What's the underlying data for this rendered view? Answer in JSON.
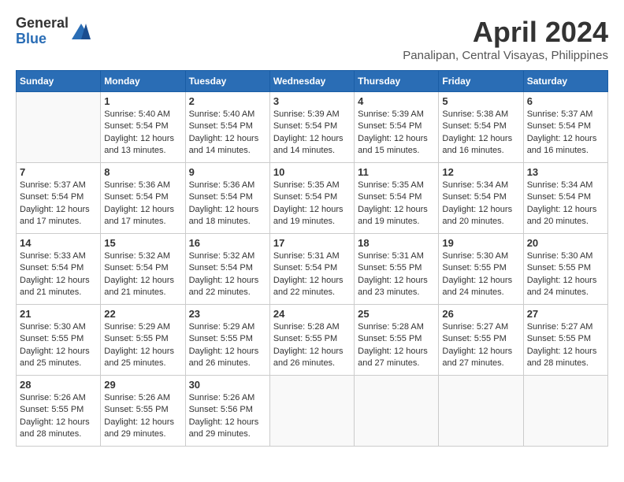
{
  "logo": {
    "general": "General",
    "blue": "Blue"
  },
  "title": {
    "month": "April 2024",
    "location": "Panalipan, Central Visayas, Philippines"
  },
  "headers": [
    "Sunday",
    "Monday",
    "Tuesday",
    "Wednesday",
    "Thursday",
    "Friday",
    "Saturday"
  ],
  "weeks": [
    [
      {
        "day": "",
        "info": ""
      },
      {
        "day": "1",
        "info": "Sunrise: 5:40 AM\nSunset: 5:54 PM\nDaylight: 12 hours\nand 13 minutes."
      },
      {
        "day": "2",
        "info": "Sunrise: 5:40 AM\nSunset: 5:54 PM\nDaylight: 12 hours\nand 14 minutes."
      },
      {
        "day": "3",
        "info": "Sunrise: 5:39 AM\nSunset: 5:54 PM\nDaylight: 12 hours\nand 14 minutes."
      },
      {
        "day": "4",
        "info": "Sunrise: 5:39 AM\nSunset: 5:54 PM\nDaylight: 12 hours\nand 15 minutes."
      },
      {
        "day": "5",
        "info": "Sunrise: 5:38 AM\nSunset: 5:54 PM\nDaylight: 12 hours\nand 16 minutes."
      },
      {
        "day": "6",
        "info": "Sunrise: 5:37 AM\nSunset: 5:54 PM\nDaylight: 12 hours\nand 16 minutes."
      }
    ],
    [
      {
        "day": "7",
        "info": "Sunrise: 5:37 AM\nSunset: 5:54 PM\nDaylight: 12 hours\nand 17 minutes."
      },
      {
        "day": "8",
        "info": "Sunrise: 5:36 AM\nSunset: 5:54 PM\nDaylight: 12 hours\nand 17 minutes."
      },
      {
        "day": "9",
        "info": "Sunrise: 5:36 AM\nSunset: 5:54 PM\nDaylight: 12 hours\nand 18 minutes."
      },
      {
        "day": "10",
        "info": "Sunrise: 5:35 AM\nSunset: 5:54 PM\nDaylight: 12 hours\nand 19 minutes."
      },
      {
        "day": "11",
        "info": "Sunrise: 5:35 AM\nSunset: 5:54 PM\nDaylight: 12 hours\nand 19 minutes."
      },
      {
        "day": "12",
        "info": "Sunrise: 5:34 AM\nSunset: 5:54 PM\nDaylight: 12 hours\nand 20 minutes."
      },
      {
        "day": "13",
        "info": "Sunrise: 5:34 AM\nSunset: 5:54 PM\nDaylight: 12 hours\nand 20 minutes."
      }
    ],
    [
      {
        "day": "14",
        "info": "Sunrise: 5:33 AM\nSunset: 5:54 PM\nDaylight: 12 hours\nand 21 minutes."
      },
      {
        "day": "15",
        "info": "Sunrise: 5:32 AM\nSunset: 5:54 PM\nDaylight: 12 hours\nand 21 minutes."
      },
      {
        "day": "16",
        "info": "Sunrise: 5:32 AM\nSunset: 5:54 PM\nDaylight: 12 hours\nand 22 minutes."
      },
      {
        "day": "17",
        "info": "Sunrise: 5:31 AM\nSunset: 5:54 PM\nDaylight: 12 hours\nand 22 minutes."
      },
      {
        "day": "18",
        "info": "Sunrise: 5:31 AM\nSunset: 5:55 PM\nDaylight: 12 hours\nand 23 minutes."
      },
      {
        "day": "19",
        "info": "Sunrise: 5:30 AM\nSunset: 5:55 PM\nDaylight: 12 hours\nand 24 minutes."
      },
      {
        "day": "20",
        "info": "Sunrise: 5:30 AM\nSunset: 5:55 PM\nDaylight: 12 hours\nand 24 minutes."
      }
    ],
    [
      {
        "day": "21",
        "info": "Sunrise: 5:30 AM\nSunset: 5:55 PM\nDaylight: 12 hours\nand 25 minutes."
      },
      {
        "day": "22",
        "info": "Sunrise: 5:29 AM\nSunset: 5:55 PM\nDaylight: 12 hours\nand 25 minutes."
      },
      {
        "day": "23",
        "info": "Sunrise: 5:29 AM\nSunset: 5:55 PM\nDaylight: 12 hours\nand 26 minutes."
      },
      {
        "day": "24",
        "info": "Sunrise: 5:28 AM\nSunset: 5:55 PM\nDaylight: 12 hours\nand 26 minutes."
      },
      {
        "day": "25",
        "info": "Sunrise: 5:28 AM\nSunset: 5:55 PM\nDaylight: 12 hours\nand 27 minutes."
      },
      {
        "day": "26",
        "info": "Sunrise: 5:27 AM\nSunset: 5:55 PM\nDaylight: 12 hours\nand 27 minutes."
      },
      {
        "day": "27",
        "info": "Sunrise: 5:27 AM\nSunset: 5:55 PM\nDaylight: 12 hours\nand 28 minutes."
      }
    ],
    [
      {
        "day": "28",
        "info": "Sunrise: 5:26 AM\nSunset: 5:55 PM\nDaylight: 12 hours\nand 28 minutes."
      },
      {
        "day": "29",
        "info": "Sunrise: 5:26 AM\nSunset: 5:55 PM\nDaylight: 12 hours\nand 29 minutes."
      },
      {
        "day": "30",
        "info": "Sunrise: 5:26 AM\nSunset: 5:56 PM\nDaylight: 12 hours\nand 29 minutes."
      },
      {
        "day": "",
        "info": ""
      },
      {
        "day": "",
        "info": ""
      },
      {
        "day": "",
        "info": ""
      },
      {
        "day": "",
        "info": ""
      }
    ]
  ]
}
